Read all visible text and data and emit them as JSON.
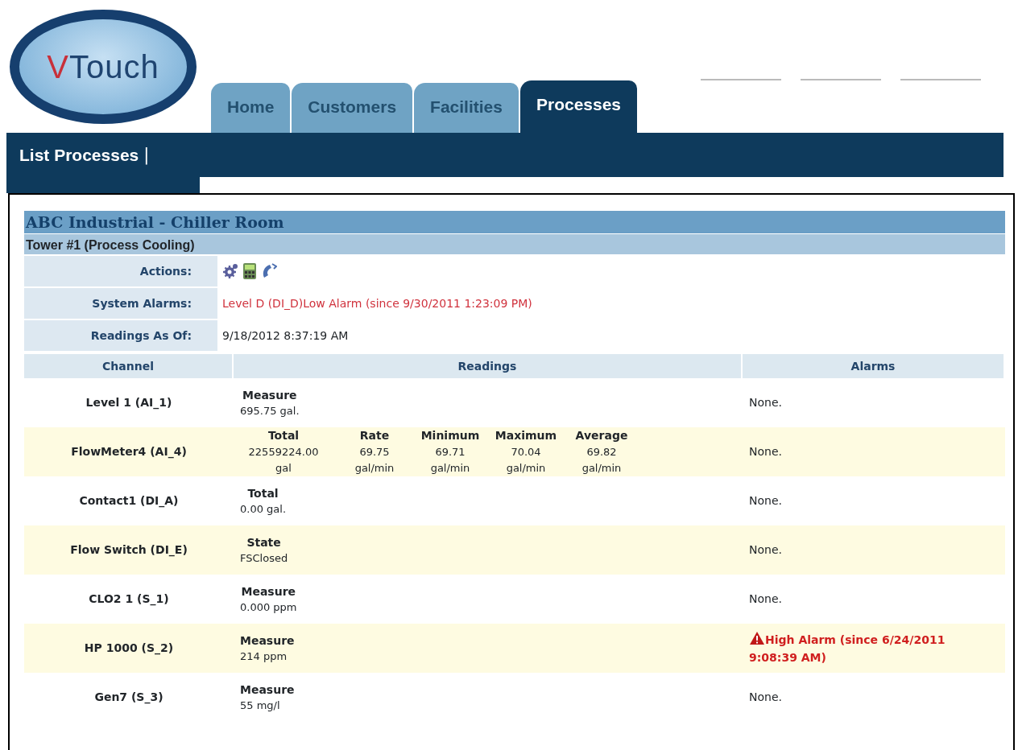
{
  "logo": {
    "text": "VTouch"
  },
  "tabs": [
    {
      "label": "Home",
      "selected": false
    },
    {
      "label": "Customers",
      "selected": false
    },
    {
      "label": "Facilities",
      "selected": false
    },
    {
      "label": "Processes",
      "selected": true
    }
  ],
  "subnav": {
    "links": [
      "List Processes"
    ],
    "separator": "|"
  },
  "site": {
    "title": "ABC Industrial - Chiller Room",
    "process": "Tower #1 (Process Cooling)"
  },
  "info": [
    {
      "label": "Actions:",
      "kind": "actions"
    },
    {
      "label": "System Alarms:",
      "kind": "alarm",
      "value": "Level D (DI_D)Low Alarm (since 9/30/2011 1:23:09 PM)"
    },
    {
      "label": "Readings As Of:",
      "kind": "text",
      "value": "9/18/2012 8:37:19 AM"
    }
  ],
  "table": {
    "columns": [
      "Channel",
      "Readings",
      "Alarms"
    ],
    "rows": [
      {
        "channel": "Level 1 (AI_1)",
        "readings": [
          {
            "label": "Measure",
            "value": "695.75 gal."
          }
        ],
        "alarm": {
          "kind": "none",
          "text": "None."
        }
      },
      {
        "channel": "FlowMeter4 (AI_4)",
        "readings": [
          {
            "label": "Total",
            "value": "22559224.00\ngal"
          },
          {
            "label": "Rate",
            "value": "69.75\ngal/min"
          },
          {
            "label": "Minimum",
            "value": "69.71\ngal/min"
          },
          {
            "label": "Maximum",
            "value": "70.04\ngal/min"
          },
          {
            "label": "Average",
            "value": "69.82\ngal/min"
          }
        ],
        "alarm": {
          "kind": "none",
          "text": "None."
        }
      },
      {
        "channel": "Contact1 (DI_A)",
        "readings": [
          {
            "label": "Total",
            "value": "0.00 gal."
          }
        ],
        "alarm": {
          "kind": "none",
          "text": "None."
        }
      },
      {
        "channel": "Flow Switch (DI_E)",
        "readings": [
          {
            "label": "State",
            "value": "FSClosed"
          }
        ],
        "alarm": {
          "kind": "none",
          "text": "None."
        }
      },
      {
        "channel": "CLO2 1 (S_1)",
        "readings": [
          {
            "label": "Measure",
            "value": "0.000 ppm"
          }
        ],
        "alarm": {
          "kind": "none",
          "text": "None."
        }
      },
      {
        "channel": "HP 1000 (S_2)",
        "readings": [
          {
            "label": "Measure",
            "value": "214 ppm"
          }
        ],
        "alarm": {
          "kind": "alarm",
          "text": "High Alarm (since 6/24/2011 9:08:39 AM)"
        }
      },
      {
        "channel": "Gen7 (S_3)",
        "readings": [
          {
            "label": "Measure",
            "value": "55 mg/l"
          }
        ],
        "alarm": {
          "kind": "none",
          "text": "None."
        }
      }
    ]
  }
}
